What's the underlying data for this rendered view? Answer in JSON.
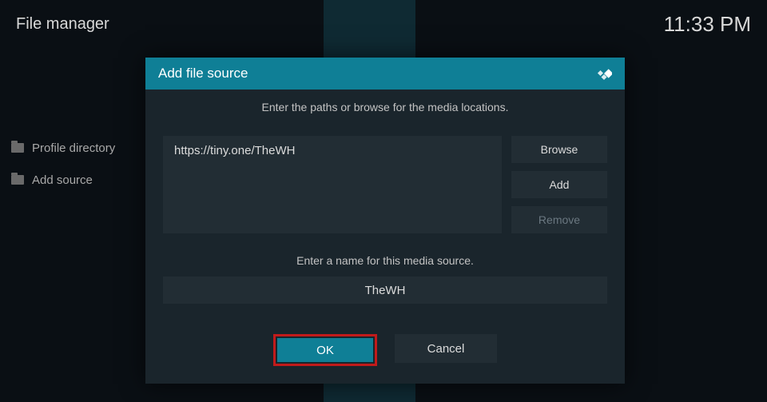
{
  "header": {
    "title": "File manager",
    "time": "11:33 PM"
  },
  "sidebar": {
    "items": [
      {
        "label": "Profile directory"
      },
      {
        "label": "Add source"
      }
    ]
  },
  "dialog": {
    "title": "Add file source",
    "instruction": "Enter the paths or browse for the media locations.",
    "paths": [
      "https://tiny.one/TheWH"
    ],
    "buttons": {
      "browse": "Browse",
      "add": "Add",
      "remove": "Remove"
    },
    "name_label": "Enter a name for this media source.",
    "source_name": "TheWH",
    "ok_label": "OK",
    "cancel_label": "Cancel"
  }
}
